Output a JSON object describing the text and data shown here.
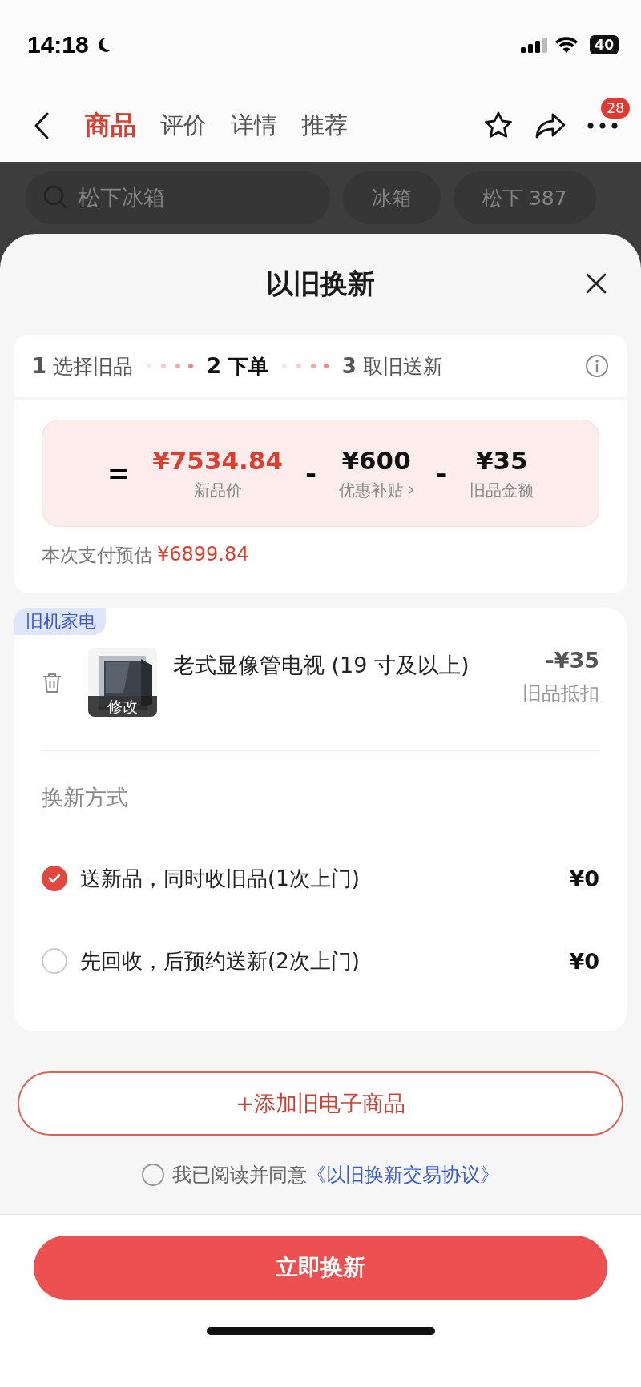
{
  "status_bar": {
    "time": "14:18",
    "battery": "40"
  },
  "nav": {
    "tabs": [
      {
        "label": "商品",
        "selected": true
      },
      {
        "label": "评价",
        "selected": false
      },
      {
        "label": "详情",
        "selected": false
      },
      {
        "label": "推荐",
        "selected": false
      }
    ],
    "more_badge": "28"
  },
  "background": {
    "search": {
      "placeholder": "松下冰箱"
    },
    "chips": [
      "冰箱",
      "松下 387"
    ]
  },
  "sheet": {
    "title": "以旧换新",
    "steps": [
      {
        "number": "1",
        "label": "选择旧品",
        "selected": false
      },
      {
        "number": "2",
        "label": "下单",
        "selected": true
      },
      {
        "number": "3",
        "label": "取旧送新",
        "selected": false
      }
    ],
    "formula": {
      "equals": "=",
      "terms": [
        {
          "amount": "¥7534.84",
          "label": "新品价",
          "kind": "highlight"
        },
        {
          "amount": "¥600",
          "label": "优惠补贴",
          "kind": "link"
        },
        {
          "amount": "¥35",
          "label": "旧品金额",
          "kind": "plain"
        }
      ],
      "minus": "-"
    },
    "estimate": {
      "label": "本次支付预估",
      "amount": "¥6899.84"
    },
    "item_card": {
      "tag": "旧机家电",
      "item": {
        "name": "老式显像管电视 (19 寸及以上)",
        "edit": "修改",
        "amount": "-¥35",
        "amount_label": "旧品抵扣"
      },
      "method_title": "换新方式",
      "options": [
        {
          "label": "送新品，同时收旧品(1次上门)",
          "price": "¥0",
          "selected": true
        },
        {
          "label": "先回收，后预约送新(2次上门)",
          "price": "¥0",
          "selected": false
        }
      ]
    },
    "add_button": "+添加旧电子商品",
    "agreement": {
      "checked": false,
      "text": "我已阅读并同意",
      "link": "《以旧换新交易协议》"
    },
    "submit": "立即换新"
  }
}
